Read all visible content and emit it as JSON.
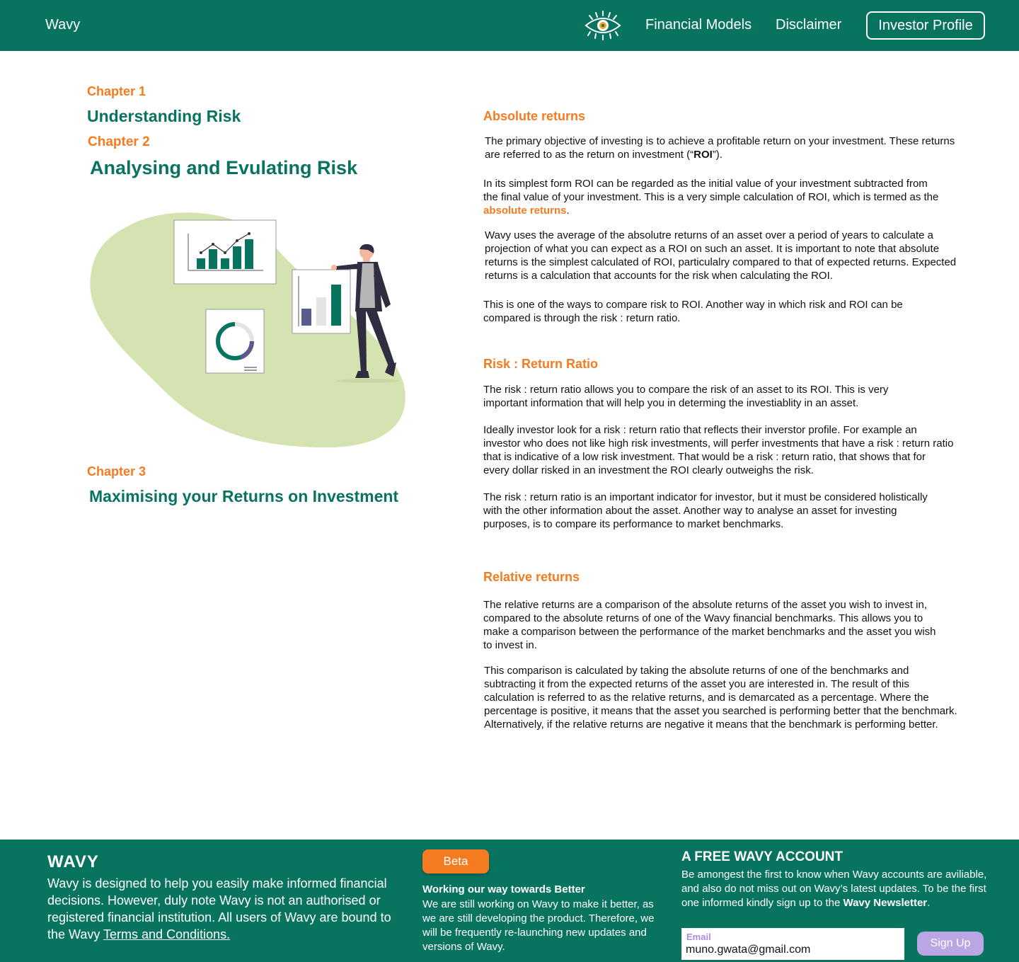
{
  "header": {
    "brand": "Wavy",
    "logo_icon": "eye-icon",
    "nav": {
      "financial_models": "Financial Models",
      "disclaimer": "Disclaimer",
      "investor_profile": "Investor Profile"
    }
  },
  "chapters": [
    {
      "label": "Chapter 1",
      "title": "Understanding Risk"
    },
    {
      "label": "Chapter 2",
      "title": "Analysing and Evulating Risk"
    },
    {
      "label": "Chapter 3",
      "title": "Maximising your Returns on Investment"
    }
  ],
  "sections": {
    "absolute": {
      "heading": "Absolute returns",
      "p1_before": "The primary objective of investing is to achieve a profitable return on your investment. These returns are referred to as the return on investment (“",
      "p1_bold": "ROI",
      "p1_after": "”).",
      "p2_before": "In its simplest form ROI can be regarded as the initial value of your investment subtracted from the final value of your investment. This is a very simple calculation of ROI, which is termed as the ",
      "p2_accent": "absolute returns",
      "p2_after": ".",
      "p3": "Wavy uses the average of the absolutre returns of an asset over a period of years to calculate a projection of what you can expect as a ROI on such an asset. It is important to note that absolute returns is the simplest calculated of ROI, particulalry compared to that of expected returns. Expected returns is a calculation that accounts for the risk when calculating the ROI.",
      "p4": "This is one of the ways to compare risk to ROI. Another way in which risk and ROI can be compared is through the risk : return ratio."
    },
    "risk_return": {
      "heading": "Risk : Return Ratio",
      "p1": "The risk : return ratio allows you to compare the risk of an asset to its ROI. This is very important information that will help you in determing the investiablity in an asset.",
      "p2": "Ideally investor look for a risk : return ratio that reflects their inverstor profile. For example an investor who does not like high risk investments, will perfer investments that have a risk : return ratio that is indicative of a low risk investment. That would be a risk : return ratio, that shows that for every dollar risked in an investment the ROI clearly outweighs the risk.",
      "p3": "The risk : return ratio is an important indicator for investor, but it must be considered holistically with the other information about the asset. Another way to analyse an asset for investing purposes, is to compare its performance to market benchmarks."
    },
    "relative": {
      "heading": "Relative returns",
      "p1": "The relative returns are a comparison of the absolute returns of the asset you wish to invest in, compared to the absolute returns of one of the Wavy financial benchmarks. This allows you to make a comparison between the performance of the market benchmarks and the asset you wish to invest in.",
      "p2": "This comparison is calculated by taking the absolute returns of one of the benchmarks and subtracting it from the expected returns of the asset you are interested in. The result of this calculation is referred to as the relative returns, and is demarcated as a percentage. Where the percentage is positive, it means that the asset you searched is performing better that the benchmark. Alternatively, if the relative returns are negative it means that the benchmark is performing better."
    }
  },
  "footer": {
    "brand": "WAVY",
    "desc_before": "Wavy is designed to help you easily make informed financial decisions. However, duly note Wavy is not an authorised or registered financial institution. All users of Wavy are bound to the Wavy ",
    "desc_link": "Terms and Conditions.",
    "beta": "Beta",
    "mid_title": "Working our way towards Better",
    "mid_text": "We are still working on Wavy to make it better, as we are still developing the product. Therefore, we will be frequently re-launching new updates and versions of Wavy.",
    "right_title": "A FREE WAVY ACCOUNT",
    "right_text_before": "Be amongest the first to know when Wavy accounts are aviliable, and also do not miss out on Wavy’s latest updates. To be the first one informed kindly sign up to the ",
    "right_text_bold": "Wavy Newsletter",
    "right_text_after": ".",
    "email_label": "Email",
    "email_value": "muno.gwata@gmail.com",
    "signup": "Sign Up"
  },
  "colors": {
    "brand_green": "#08735f",
    "accent_orange": "#f47b20",
    "highlight_green": "#c5de9b",
    "signup_purple": "#b9a6e2"
  }
}
